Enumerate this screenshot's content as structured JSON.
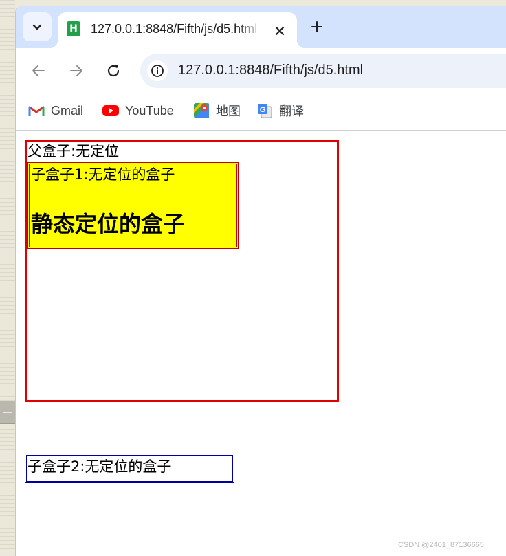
{
  "browser": {
    "tab": {
      "favicon_letter": "H",
      "title": "127.0.0.1:8848/Fifth/js/d5.html"
    },
    "address_bar": {
      "url": "127.0.0.1:8848/Fifth/js/d5.html"
    },
    "bookmarks": [
      {
        "label": "Gmail",
        "icon": "gmail-icon"
      },
      {
        "label": "YouTube",
        "icon": "youtube-icon"
      },
      {
        "label": "地图",
        "icon": "maps-icon"
      },
      {
        "label": "翻译",
        "icon": "translate-icon"
      }
    ]
  },
  "page": {
    "parent_label": "父盒子:无定位",
    "child1_label": "子盒子1:无定位的盒子",
    "child1_heading": "静态定位的盒子",
    "child2_label": "子盒子2:无定位的盒子",
    "watermark": "CSDN @2401_87136665"
  },
  "colors": {
    "parent_border": "#e00000",
    "child1_background": "#ffff00",
    "child1_border": "#c00000",
    "child2_border": "#0000a0",
    "tabstrip": "#d3e3fd"
  }
}
